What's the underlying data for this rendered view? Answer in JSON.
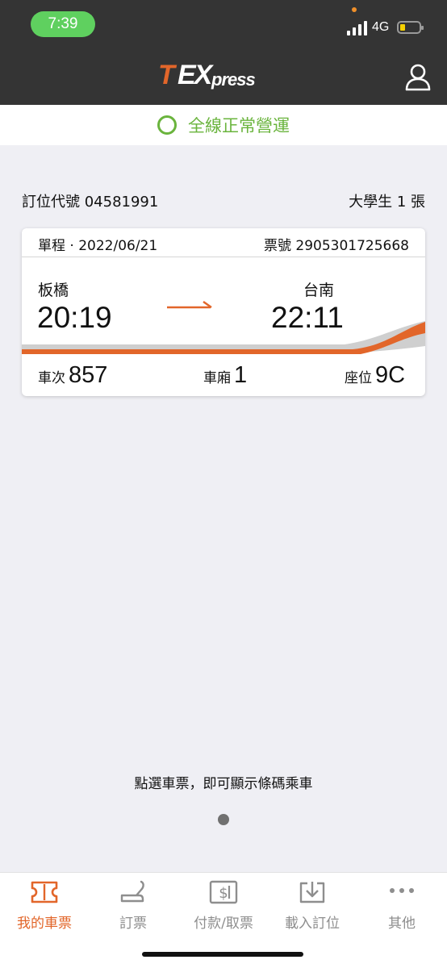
{
  "status_bar": {
    "time": "7:39",
    "network": "4G"
  },
  "header": {
    "logo": {
      "part_t": "T",
      "part_ex": "EX",
      "part_press": "press"
    },
    "user_icon": "user-icon"
  },
  "service_status": {
    "text": "全線正常營運",
    "color": "#6ab43d"
  },
  "booking": {
    "code_label": "訂位代號 04581991",
    "passengers": "大學生 1 張"
  },
  "ticket": {
    "trip": "單程 · 2022/06/21",
    "ticket_no": "票號 2905301725668",
    "origin": {
      "station": "板橋",
      "time": "20:19"
    },
    "destination": {
      "station": "台南",
      "time": "22:11"
    },
    "train": {
      "label": "車次",
      "value": "857"
    },
    "car": {
      "label": "車廂",
      "value": "1"
    },
    "seat": {
      "label": "座位",
      "value": "9C"
    }
  },
  "hint": "點選車票，即可顯示條碼乘車",
  "tabs": [
    {
      "label": "我的車票",
      "icon": "ticket-icon",
      "active": true
    },
    {
      "label": "訂票",
      "icon": "seat-icon",
      "active": false
    },
    {
      "label": "付款/取票",
      "icon": "payment-icon",
      "active": false
    },
    {
      "label": "載入訂位",
      "icon": "download-icon",
      "active": false
    },
    {
      "label": "其他",
      "icon": "more-icon",
      "active": false
    }
  ],
  "colors": {
    "accent": "#e2662a",
    "header_bg": "#343434",
    "page_bg": "#efeff4",
    "inactive": "#8e8e8e"
  }
}
